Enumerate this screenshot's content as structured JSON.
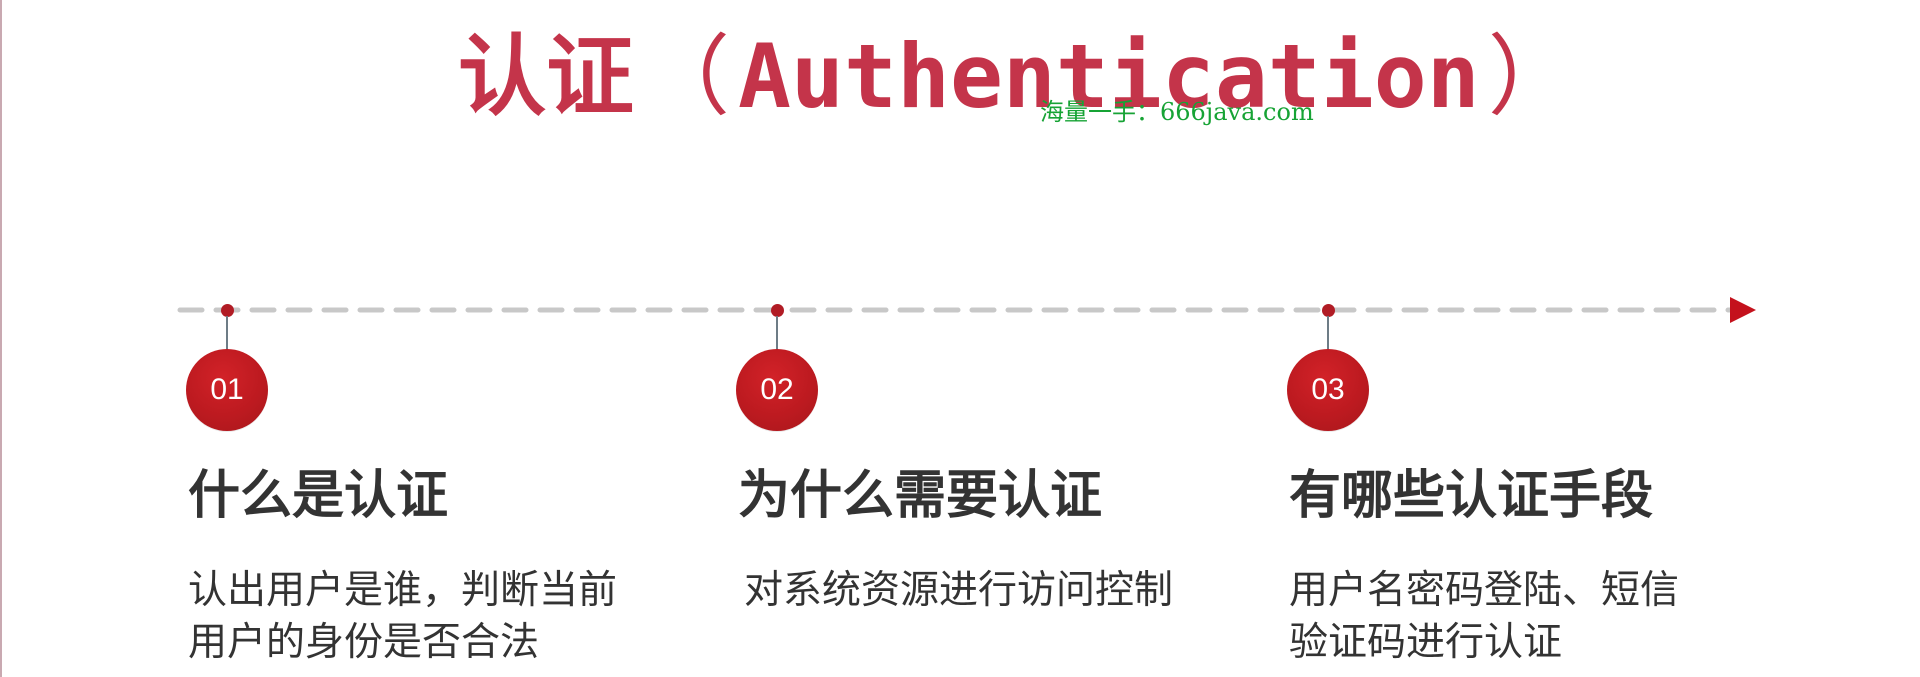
{
  "title": {
    "cn": "认证",
    "open_paren": "（",
    "en": "Authentication",
    "close_paren": "）"
  },
  "watermark": "海量一手：666java.com",
  "colors": {
    "accent": "#c4344a",
    "badge": "#b11c25",
    "text": "#333333",
    "timeline": "#c8c8c8",
    "watermark": "#17a335"
  },
  "steps": [
    {
      "number": "01",
      "title": "什么是认证",
      "description": "认出用户是谁，判断当前\n用户的身份是否合法"
    },
    {
      "number": "02",
      "title": "为什么需要认证",
      "description": "对系统资源进行访问控制"
    },
    {
      "number": "03",
      "title": "有哪些认证手段",
      "description": "用户名密码登陆、短信\n验证码进行认证"
    }
  ]
}
